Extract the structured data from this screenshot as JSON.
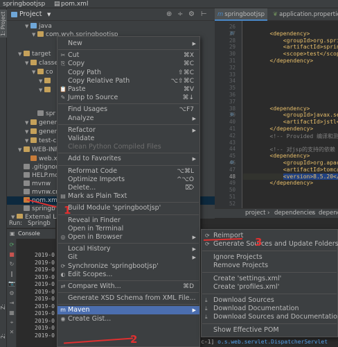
{
  "window": {
    "title_project": "springbootjsp",
    "title_file": "pom.xml"
  },
  "left_strip": {
    "tab1": "1: Project",
    "tab2": "Z: Structure",
    "tab3": "2: Favorites"
  },
  "project_panel": {
    "label": "Project",
    "tree": [
      {
        "label": "java",
        "indent": 2,
        "type": "folder-blue"
      },
      {
        "label": "com.wyh.springbootjsp",
        "indent": 3,
        "type": "folder"
      },
      {
        "label": "target",
        "indent": 1,
        "type": "folder"
      },
      {
        "label": "classe",
        "indent": 2,
        "type": "folder"
      },
      {
        "label": "co",
        "indent": 3,
        "type": "folder"
      },
      {
        "label": "",
        "indent": 4,
        "type": "folder"
      },
      {
        "label": "",
        "indent": 4,
        "type": "folder"
      },
      {
        "label": "spr",
        "indent": 3,
        "type": "file"
      },
      {
        "label": "genera",
        "indent": 2,
        "type": "folder"
      },
      {
        "label": "genera",
        "indent": 2,
        "type": "folder"
      },
      {
        "label": "test-c",
        "indent": 2,
        "type": "folder"
      },
      {
        "label": "WEB-INF",
        "indent": 1,
        "type": "folder"
      },
      {
        "label": "web.x",
        "indent": 2,
        "type": "file-x"
      },
      {
        "label": ".gitignore",
        "indent": 1,
        "type": "file-g"
      },
      {
        "label": "HELP.md",
        "indent": 1,
        "type": "file-g"
      },
      {
        "label": "mvnw",
        "indent": 1,
        "type": "file-g"
      },
      {
        "label": "mvnw.cm",
        "indent": 1,
        "type": "file-g"
      },
      {
        "label": "pom.xml",
        "indent": 1,
        "type": "file-x",
        "selected": true
      },
      {
        "label": "springb",
        "indent": 1,
        "type": "file-g"
      },
      {
        "label": "External Libr",
        "indent": 0,
        "type": "folder"
      }
    ]
  },
  "run_panel": {
    "run_label": "Run:",
    "run_config": "Springb",
    "console_tab": "Console",
    "log_lines": [
      "2019-0",
      "2019-0",
      "2019-0",
      "2019-0",
      "2019-0",
      "2019-0",
      "2019-0",
      "2019-0",
      "2019-0",
      "2019-0",
      "2019-0",
      "2019-0"
    ]
  },
  "editor": {
    "tabs": [
      {
        "label": "springbootjsp",
        "prefix": "m",
        "active": true
      },
      {
        "label": "application.properties",
        "prefix": "leaf",
        "active": false
      }
    ],
    "line_numbers": [
      "26",
      "27",
      "28",
      "29",
      "30",
      "31",
      "32",
      "33",
      "34",
      "35",
      "36",
      "37",
      "38",
      "39",
      "40",
      "41",
      "42",
      "43",
      "44",
      "45",
      "46",
      "47",
      "48",
      "49",
      "50",
      "51",
      "52"
    ],
    "current_line": "48",
    "code_lines": [
      {
        "text": "",
        "kind": "tag"
      },
      {
        "text": "        <dependency>",
        "kind": "tag"
      },
      {
        "text": "            <groupId>org.sprin",
        "kind": "tag"
      },
      {
        "text": "            <artifactId>spring",
        "kind": "tag"
      },
      {
        "text": "            <scope>test</scope>",
        "kind": "tag"
      },
      {
        "text": "        </dependency>",
        "kind": "tag"
      },
      {
        "text": "",
        "kind": "tag"
      },
      {
        "text": "",
        "kind": "tag"
      },
      {
        "text": "",
        "kind": "tag"
      },
      {
        "text": "",
        "kind": "tag"
      },
      {
        "text": "",
        "kind": "tag"
      },
      {
        "text": "",
        "kind": "tag"
      },
      {
        "text": "        <dependency>",
        "kind": "tag"
      },
      {
        "text": "            <groupId>javax.serv",
        "kind": "tag"
      },
      {
        "text": "            <artifactId>jstl</",
        "kind": "tag"
      },
      {
        "text": "        </dependency>",
        "kind": "tag"
      },
      {
        "text": "        <!-- Provided 编译和测试",
        "kind": "cmt"
      },
      {
        "text": "",
        "kind": "tag"
      },
      {
        "text": "        <!-- 对jsp的支持的依赖 -->",
        "kind": "cmt"
      },
      {
        "text": "        <dependency>",
        "kind": "tag"
      },
      {
        "text": "            <groupId>org.apache",
        "kind": "tag"
      },
      {
        "text": "            <artifactId>tomcat-",
        "kind": "tag"
      },
      {
        "text": "            <version>8.5.20</v",
        "kind": "sel"
      },
      {
        "text": "        </dependency>",
        "kind": "tag"
      },
      {
        "text": "",
        "kind": "tag"
      },
      {
        "text": "",
        "kind": "tag"
      },
      {
        "text": "",
        "kind": "tag"
      }
    ],
    "breadcrumb": [
      "project",
      "dependencies",
      "dependency"
    ]
  },
  "status_log": {
    "prefix": "c-1]",
    "pkg": "o.s.web.servlet.DispatcherServlet"
  },
  "context_menu": {
    "items": [
      {
        "type": "item",
        "label": "New",
        "submenu": true,
        "icon": ""
      },
      {
        "type": "sep"
      },
      {
        "type": "item",
        "label": "Cut",
        "shortcut": "⌘X",
        "icon": "✂"
      },
      {
        "type": "item",
        "label": "Copy",
        "shortcut": "⌘C",
        "icon": "⎘"
      },
      {
        "type": "item",
        "label": "Copy Path",
        "shortcut": "⇧⌘C"
      },
      {
        "type": "item",
        "label": "Copy Relative Path",
        "shortcut": "⌥⇧⌘C"
      },
      {
        "type": "item",
        "label": "Paste",
        "shortcut": "⌘V",
        "icon": "📋"
      },
      {
        "type": "item",
        "label": "Jump to Source",
        "shortcut": "⌘↓",
        "icon": "✎"
      },
      {
        "type": "sep"
      },
      {
        "type": "item",
        "label": "Find Usages",
        "shortcut": "⌥F7"
      },
      {
        "type": "item",
        "label": "Analyze",
        "submenu": true
      },
      {
        "type": "sep"
      },
      {
        "type": "item",
        "label": "Refactor",
        "submenu": true
      },
      {
        "type": "item",
        "label": "Validate"
      },
      {
        "type": "item",
        "label": "Clean Python Compiled Files",
        "disabled": true
      },
      {
        "type": "sep"
      },
      {
        "type": "item",
        "label": "Add to Favorites",
        "submenu": true
      },
      {
        "type": "sep"
      },
      {
        "type": "item",
        "label": "Reformat Code",
        "shortcut": "⌥⌘L"
      },
      {
        "type": "item",
        "label": "Optimize Imports",
        "shortcut": "^⌥O"
      },
      {
        "type": "item",
        "label": "Delete...",
        "shortcut": "⌦"
      },
      {
        "type": "item",
        "label": "Mark as Plain Text",
        "icon": "▤"
      },
      {
        "type": "sep"
      },
      {
        "type": "item",
        "label": "Build Module 'springbootjsp'"
      },
      {
        "type": "sep"
      },
      {
        "type": "item",
        "label": "Reveal in Finder"
      },
      {
        "type": "item",
        "label": "Open in Terminal"
      },
      {
        "type": "item",
        "label": "Open in Browser",
        "submenu": true,
        "icon": "◎"
      },
      {
        "type": "sep"
      },
      {
        "type": "item",
        "label": "Local History",
        "submenu": true
      },
      {
        "type": "item",
        "label": "Git",
        "submenu": true
      },
      {
        "type": "item",
        "label": "Synchronize 'springbootjsp'",
        "icon": "⟳"
      },
      {
        "type": "item",
        "label": "Edit Scopes...",
        "icon": "◐"
      },
      {
        "type": "sep"
      },
      {
        "type": "item",
        "label": "Compare With...",
        "shortcut": "⌘D",
        "icon": "⇄"
      },
      {
        "type": "sep"
      },
      {
        "type": "item",
        "label": "Generate XSD Schema from XML File..."
      },
      {
        "type": "sep"
      },
      {
        "type": "item",
        "label": "Maven",
        "submenu": true,
        "active": true,
        "icon": "m"
      },
      {
        "type": "item",
        "label": "Create Gist...",
        "icon": "◉"
      }
    ]
  },
  "maven_submenu": {
    "items": [
      {
        "type": "item",
        "label": "Reimport",
        "icon": "⟳"
      },
      {
        "type": "item",
        "label": "Generate Sources and Update Folders",
        "icon": "⟳"
      },
      {
        "type": "sep"
      },
      {
        "type": "item",
        "label": "Ignore Projects"
      },
      {
        "type": "item",
        "label": "Remove Projects"
      },
      {
        "type": "sep"
      },
      {
        "type": "item",
        "label": "Create 'settings.xml'"
      },
      {
        "type": "item",
        "label": "Create 'profiles.xml'"
      },
      {
        "type": "sep"
      },
      {
        "type": "item",
        "label": "Download Sources",
        "icon": "⤓"
      },
      {
        "type": "item",
        "label": "Download Documentation",
        "icon": "⤓"
      },
      {
        "type": "item",
        "label": "Download Sources and Documentation",
        "icon": "⤓"
      },
      {
        "type": "sep"
      },
      {
        "type": "item",
        "label": "Show Effective POM"
      }
    ]
  },
  "annotations": {
    "mark1": "1",
    "mark2": "2",
    "mark3": "3",
    "color": "#e03030"
  }
}
